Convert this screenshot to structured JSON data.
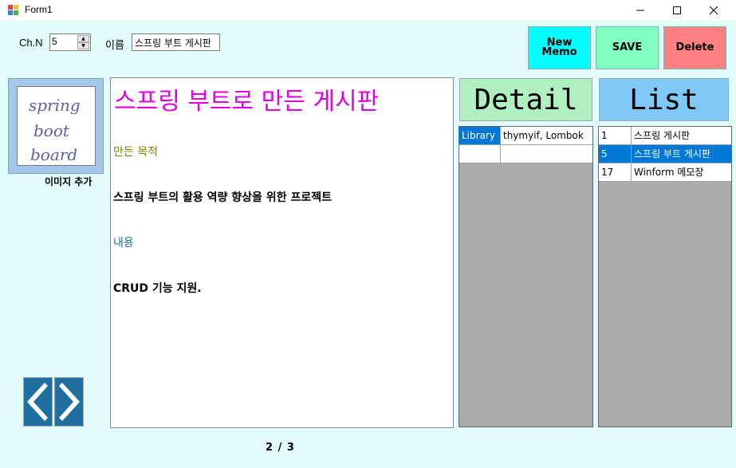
{
  "window": {
    "title": "Form1"
  },
  "toolbar": {
    "chn_label": "Ch.N",
    "chn_value": "5",
    "name_label": "이름",
    "name_value": "스프링 부트 게시판",
    "new_memo_label_1": "New",
    "new_memo_label_2": "Memo",
    "save_label": "SAVE",
    "delete_label": "Delete"
  },
  "image_panel": {
    "caption": "이미지 추가",
    "sketch_words": [
      "spring",
      "boot",
      "board"
    ]
  },
  "content": {
    "title": "스프링 부트로 만든 게시판",
    "subheading_1": "만든 목적",
    "body_1": "스프링 부트의 활용 역량 향상을 위한 프로젝트",
    "subheading_2": "내용",
    "body_2": "CRUD 기능 지원."
  },
  "navigation": {
    "page_indicator": "2  / 3"
  },
  "detail": {
    "header": "Detail",
    "rows": [
      {
        "key": "Library",
        "value": "thymyif, Lombok",
        "selected": false
      },
      {
        "key": "",
        "value": "",
        "selected": false
      }
    ]
  },
  "list": {
    "header": "List",
    "rows": [
      {
        "id": "1",
        "title": "스프링 게시판",
        "selected": false
      },
      {
        "id": "5",
        "title": "스프링 부트 게시판",
        "selected": true
      },
      {
        "id": "17",
        "title": "Winform 메모장",
        "selected": false
      }
    ]
  },
  "colors": {
    "background": "#e2fbfb",
    "new_memo_button": "#00ffff",
    "save_button": "#80ffc0",
    "delete_button": "#ff8080",
    "detail_header": "#b0f0c0",
    "list_header": "#80c8f8",
    "title_color": "#e000e0",
    "subheading_1_color": "#808000",
    "subheading_2_color": "#1e7098",
    "selection": "#0078d7"
  }
}
